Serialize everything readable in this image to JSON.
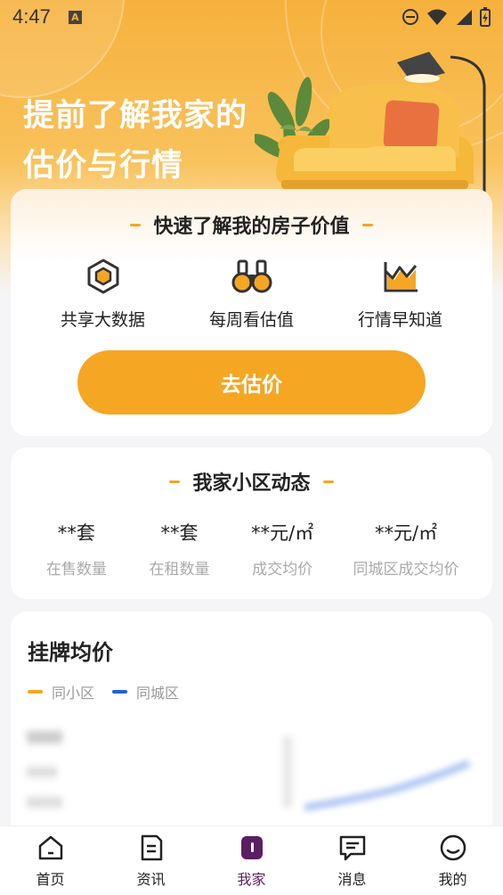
{
  "status_bar": {
    "time": "4:47"
  },
  "hero": {
    "title_line1": "提前了解我家的",
    "title_line2": "估价与行情"
  },
  "valuation_card": {
    "heading": "快速了解我的房子价值",
    "features": [
      {
        "icon": "cube-icon",
        "label": "共享大数据"
      },
      {
        "icon": "binoculars-icon",
        "label": "每周看估值"
      },
      {
        "icon": "trend-chart-icon",
        "label": "行情早知道"
      }
    ],
    "cta_label": "去估价"
  },
  "community_card": {
    "heading": "我家小区动态",
    "stats": [
      {
        "value": "**套",
        "label": "在售数量"
      },
      {
        "value": "**套",
        "label": "在租数量"
      },
      {
        "value": "**元/㎡",
        "label": "成交均价"
      },
      {
        "value": "**元/㎡",
        "label": "同城区成交均价"
      }
    ]
  },
  "listing_card": {
    "title": "挂牌均价",
    "legend": [
      {
        "label": "同小区",
        "color": "#f5a623"
      },
      {
        "label": "同城区",
        "color": "#1f5fe0"
      }
    ]
  },
  "tab_bar": {
    "tabs": [
      {
        "icon": "home-icon",
        "label": "首页",
        "active": false
      },
      {
        "icon": "document-icon",
        "label": "资讯",
        "active": false
      },
      {
        "icon": "my-home-icon",
        "label": "我家",
        "active": true
      },
      {
        "icon": "message-icon",
        "label": "消息",
        "active": false
      },
      {
        "icon": "profile-icon",
        "label": "我的",
        "active": false
      }
    ]
  },
  "colors": {
    "accent": "#f5a623",
    "active_tab": "#5a1e62",
    "blue": "#1f5fe0"
  }
}
